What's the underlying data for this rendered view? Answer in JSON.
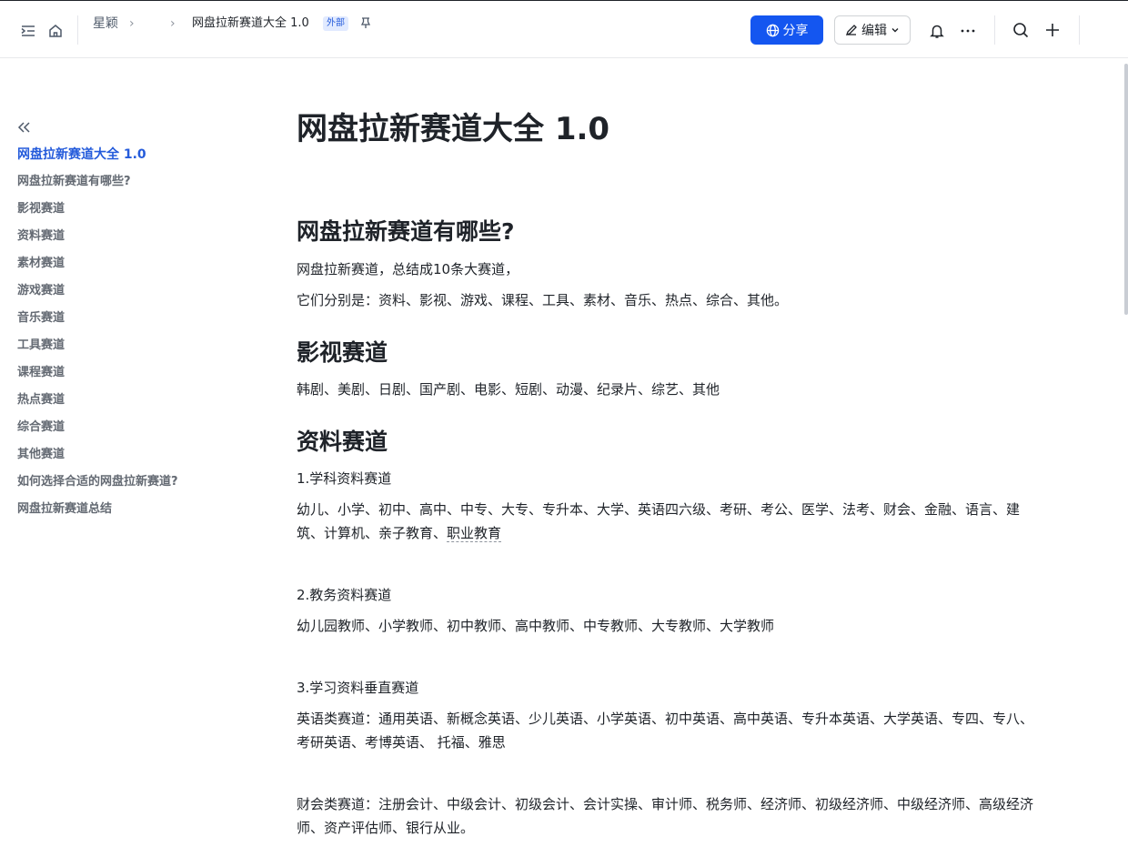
{
  "header": {
    "breadcrumb_root": "星颖",
    "breadcrumb_current": "网盘拉新赛道大全 1.0",
    "badge": "外部",
    "share_label": "分享",
    "edit_label": "编辑",
    "accent": "#1456f0"
  },
  "toc": {
    "items": [
      {
        "label": "网盘拉新赛道大全 1.0",
        "active": true
      },
      {
        "label": "网盘拉新赛道有哪些?"
      },
      {
        "label": "影视赛道"
      },
      {
        "label": "资料赛道"
      },
      {
        "label": "素材赛道"
      },
      {
        "label": "游戏赛道"
      },
      {
        "label": "音乐赛道"
      },
      {
        "label": "工具赛道"
      },
      {
        "label": "课程赛道"
      },
      {
        "label": "热点赛道"
      },
      {
        "label": "综合赛道"
      },
      {
        "label": "其他赛道"
      },
      {
        "label": "如何选择合适的网盘拉新赛道?"
      },
      {
        "label": "网盘拉新赛道总结"
      }
    ]
  },
  "doc": {
    "title": "网盘拉新赛道大全 1.0",
    "s1_heading": "网盘拉新赛道有哪些?",
    "s1_p1": "网盘拉新赛道，总结成10条大赛道，",
    "s1_p2": "它们分别是：资料、影视、游戏、课程、工具、素材、音乐、热点、综合、其他。",
    "s2_heading": "影视赛道",
    "s2_p1": "韩剧、美剧、日剧、国产剧、电影、短剧、动漫、纪录片、综艺、其他",
    "s3_heading": "资料赛道",
    "s3_sub1": "1.学科资料赛道",
    "s3_sub1_text_a": "幼儿、小学、初中、高中、中专、大专、专升本、大学、英语四六级、考研、考公、医学、法考、财会、金融、语言、建筑、计算机、亲子教育、",
    "s3_sub1_text_b": "职业教育",
    "s3_sub2": "2.教务资料赛道",
    "s3_sub2_text": "幼儿园教师、小学教师、初中教师、高中教师、中专教师、大专教师、大学教师",
    "s3_sub3": "3.学习资料垂直赛道",
    "s3_sub3_text1": "英语类赛道：通用英语、新概念英语、少儿英语、小学英语、初中英语、高中英语、专升本英语、大学英语、专四、专八、考研英语、考博英语、 托福、雅思",
    "s3_sub3_text2": "财会类赛道：注册会计、中级会计、初级会计、会计实操、审计师、税务师、经济师、初级经济师、中级经济师、高级经济师、资产评估师、银行从业。"
  }
}
